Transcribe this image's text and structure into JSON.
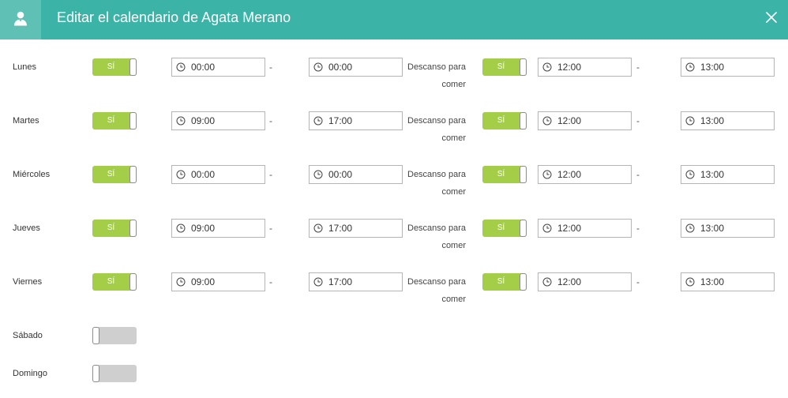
{
  "header": {
    "title": "Editar el calendario de Agata Merano",
    "icon": "user-icon",
    "close_icon": "close-icon"
  },
  "icons": {
    "time_input": "clock-icon"
  },
  "separator": "-",
  "days": [
    {
      "name": "Lunes",
      "enabled": true,
      "toggle_label": "SÍ",
      "start": "00:00",
      "end": "00:00",
      "break_label": "Descanso para comer",
      "break_enabled": true,
      "break_toggle_label": "SÍ",
      "break_start": "12:00",
      "break_end": "13:00"
    },
    {
      "name": "Martes",
      "enabled": true,
      "toggle_label": "SÍ",
      "start": "09:00",
      "end": "17:00",
      "break_label": "Descanso para comer",
      "break_enabled": true,
      "break_toggle_label": "SÍ",
      "break_start": "12:00",
      "break_end": "13:00"
    },
    {
      "name": "Miércoles",
      "enabled": true,
      "toggle_label": "SÍ",
      "start": "00:00",
      "end": "00:00",
      "break_label": "Descanso para comer",
      "break_enabled": true,
      "break_toggle_label": "SÍ",
      "break_start": "12:00",
      "break_end": "13:00"
    },
    {
      "name": "Jueves",
      "enabled": true,
      "toggle_label": "SÍ",
      "start": "09:00",
      "end": "17:00",
      "break_label": "Descanso para comer",
      "break_enabled": true,
      "break_toggle_label": "SÍ",
      "break_start": "12:00",
      "break_end": "13:00"
    },
    {
      "name": "Viernes",
      "enabled": true,
      "toggle_label": "SÍ",
      "start": "09:00",
      "end": "17:00",
      "break_label": "Descanso para comer",
      "break_enabled": true,
      "break_toggle_label": "SÍ",
      "break_start": "12:00",
      "break_end": "13:00"
    },
    {
      "name": "Sábado",
      "enabled": false
    },
    {
      "name": "Domingo",
      "enabled": false
    }
  ],
  "colors": {
    "header": "#3bb3a6",
    "header_icon_box": "#5fc0b5",
    "toggle_on": "#a4cd48",
    "toggle_off": "#cfcfcf"
  }
}
